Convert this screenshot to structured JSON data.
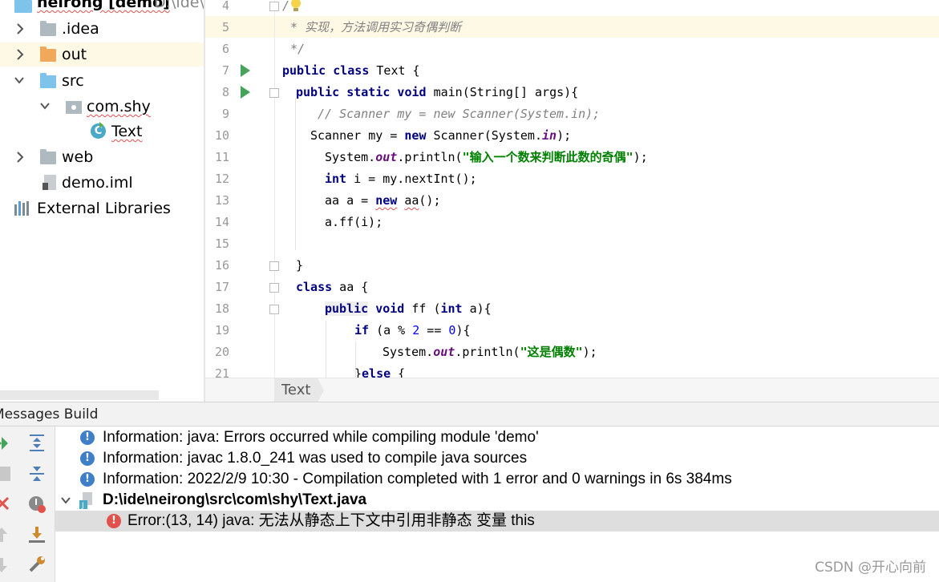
{
  "project_tree": {
    "root_label": "neirong [demo]",
    "root_path": "D:\\ide\\",
    "items": [
      {
        "label": ".idea",
        "icon": "folder-icon"
      },
      {
        "label": "out",
        "icon": "folder-orange-icon"
      },
      {
        "label": "src",
        "icon": "source-folder-icon"
      },
      {
        "label": "com.shy",
        "icon": "package-icon"
      },
      {
        "label": "Text",
        "icon": "java-class-icon"
      },
      {
        "label": "web",
        "icon": "web-folder-icon"
      },
      {
        "label": "demo.iml",
        "icon": "module-file-icon"
      },
      {
        "label": "External Libraries",
        "icon": "libraries-icon"
      }
    ]
  },
  "editor": {
    "line_numbers": [
      "4",
      "5",
      "6",
      "7",
      "8",
      "9",
      "10",
      "11",
      "12",
      "13",
      "14",
      "15",
      "16",
      "17",
      "18",
      "19",
      "20",
      "21"
    ],
    "lines": {
      "l4": "/",
      "l5": "* 实现，方法调用实习奇偶判断",
      "l6": "*/",
      "l7_kw": "public class",
      "l7_rest": " Text {",
      "l8_kw": "public static void",
      "l8_rest": " main(String[] args){",
      "l9": "// Scanner my = new Scanner(System.in);",
      "l10_a": "Scanner my = ",
      "l10_kw": "new",
      "l10_b": " Scanner(System.",
      "l10_fld": "in",
      "l10_c": ");",
      "l11_a": "System.",
      "l11_fld": "out",
      "l11_b": ".println(",
      "l11_str": "\"输入一个数来判断此数的奇偶\"",
      "l11_c": ");",
      "l12_kw": "int",
      "l12_rest": " i = my.nextInt();",
      "l13_a": "aa a = ",
      "l13_kw": "new",
      "l13_b": " ",
      "l13_c": "aa",
      "l13_d": "();",
      "l14": "a.ff(i);",
      "l16": "}",
      "l17_kw": "class",
      "l17_rest": " aa {",
      "l18_kw1": "public",
      "l18_kw2": "void",
      "l18_a": " ff (",
      "l18_kw3": "int",
      "l18_b": " a){",
      "l19_kw": "if",
      "l19_a": " (a % ",
      "l19_n1": "2",
      "l19_b": " == ",
      "l19_n2": "0",
      "l19_c": "){",
      "l20_a": "System.",
      "l20_fld": "out",
      "l20_b": ".println(",
      "l20_str": "\"这是偶数\"",
      "l20_c": ");",
      "l21_a": "}",
      "l21_kw": "else",
      "l21_b": " {"
    },
    "breadcrumb": "Text"
  },
  "messages": {
    "header": "Messages Build",
    "rows": [
      {
        "type": "info",
        "text": "Information: java: Errors occurred while compiling module 'demo'"
      },
      {
        "type": "info",
        "text": "Information: javac 1.8.0_241 was used to compile java sources"
      },
      {
        "type": "info",
        "text": "Information: 2022/2/9 10:30 - Compilation completed with 1 error and 0 warnings in 6s 384ms"
      },
      {
        "type": "file",
        "text": "D:\\ide\\neirong\\src\\com\\shy\\Text.java"
      },
      {
        "type": "error",
        "text": "Error:(13, 14)  java: 无法从静态上下文中引用非静态 变量 this"
      }
    ]
  },
  "watermark": "CSDN @开心向前",
  "colors": {
    "keyword": "#000080",
    "string": "#008000",
    "comment": "#808080",
    "field": "#660e7a",
    "number": "#0000ff",
    "run_icon": "#45a35a",
    "error_icon": "#e2514b",
    "info_icon": "#3f7fc8"
  }
}
